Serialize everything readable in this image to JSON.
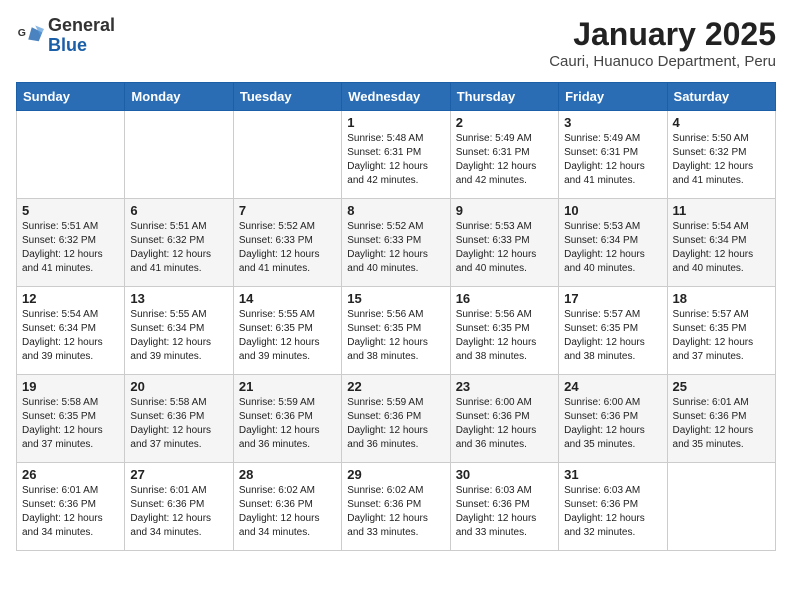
{
  "header": {
    "logo_general": "General",
    "logo_blue": "Blue",
    "title": "January 2025",
    "subtitle": "Cauri, Huanuco Department, Peru"
  },
  "weekdays": [
    "Sunday",
    "Monday",
    "Tuesday",
    "Wednesday",
    "Thursday",
    "Friday",
    "Saturday"
  ],
  "weeks": [
    [
      {
        "day": "",
        "info": ""
      },
      {
        "day": "",
        "info": ""
      },
      {
        "day": "",
        "info": ""
      },
      {
        "day": "1",
        "info": "Sunrise: 5:48 AM\nSunset: 6:31 PM\nDaylight: 12 hours and 42 minutes."
      },
      {
        "day": "2",
        "info": "Sunrise: 5:49 AM\nSunset: 6:31 PM\nDaylight: 12 hours and 42 minutes."
      },
      {
        "day": "3",
        "info": "Sunrise: 5:49 AM\nSunset: 6:31 PM\nDaylight: 12 hours and 41 minutes."
      },
      {
        "day": "4",
        "info": "Sunrise: 5:50 AM\nSunset: 6:32 PM\nDaylight: 12 hours and 41 minutes."
      }
    ],
    [
      {
        "day": "5",
        "info": "Sunrise: 5:51 AM\nSunset: 6:32 PM\nDaylight: 12 hours and 41 minutes."
      },
      {
        "day": "6",
        "info": "Sunrise: 5:51 AM\nSunset: 6:32 PM\nDaylight: 12 hours and 41 minutes."
      },
      {
        "day": "7",
        "info": "Sunrise: 5:52 AM\nSunset: 6:33 PM\nDaylight: 12 hours and 41 minutes."
      },
      {
        "day": "8",
        "info": "Sunrise: 5:52 AM\nSunset: 6:33 PM\nDaylight: 12 hours and 40 minutes."
      },
      {
        "day": "9",
        "info": "Sunrise: 5:53 AM\nSunset: 6:33 PM\nDaylight: 12 hours and 40 minutes."
      },
      {
        "day": "10",
        "info": "Sunrise: 5:53 AM\nSunset: 6:34 PM\nDaylight: 12 hours and 40 minutes."
      },
      {
        "day": "11",
        "info": "Sunrise: 5:54 AM\nSunset: 6:34 PM\nDaylight: 12 hours and 40 minutes."
      }
    ],
    [
      {
        "day": "12",
        "info": "Sunrise: 5:54 AM\nSunset: 6:34 PM\nDaylight: 12 hours and 39 minutes."
      },
      {
        "day": "13",
        "info": "Sunrise: 5:55 AM\nSunset: 6:34 PM\nDaylight: 12 hours and 39 minutes."
      },
      {
        "day": "14",
        "info": "Sunrise: 5:55 AM\nSunset: 6:35 PM\nDaylight: 12 hours and 39 minutes."
      },
      {
        "day": "15",
        "info": "Sunrise: 5:56 AM\nSunset: 6:35 PM\nDaylight: 12 hours and 38 minutes."
      },
      {
        "day": "16",
        "info": "Sunrise: 5:56 AM\nSunset: 6:35 PM\nDaylight: 12 hours and 38 minutes."
      },
      {
        "day": "17",
        "info": "Sunrise: 5:57 AM\nSunset: 6:35 PM\nDaylight: 12 hours and 38 minutes."
      },
      {
        "day": "18",
        "info": "Sunrise: 5:57 AM\nSunset: 6:35 PM\nDaylight: 12 hours and 37 minutes."
      }
    ],
    [
      {
        "day": "19",
        "info": "Sunrise: 5:58 AM\nSunset: 6:35 PM\nDaylight: 12 hours and 37 minutes."
      },
      {
        "day": "20",
        "info": "Sunrise: 5:58 AM\nSunset: 6:36 PM\nDaylight: 12 hours and 37 minutes."
      },
      {
        "day": "21",
        "info": "Sunrise: 5:59 AM\nSunset: 6:36 PM\nDaylight: 12 hours and 36 minutes."
      },
      {
        "day": "22",
        "info": "Sunrise: 5:59 AM\nSunset: 6:36 PM\nDaylight: 12 hours and 36 minutes."
      },
      {
        "day": "23",
        "info": "Sunrise: 6:00 AM\nSunset: 6:36 PM\nDaylight: 12 hours and 36 minutes."
      },
      {
        "day": "24",
        "info": "Sunrise: 6:00 AM\nSunset: 6:36 PM\nDaylight: 12 hours and 35 minutes."
      },
      {
        "day": "25",
        "info": "Sunrise: 6:01 AM\nSunset: 6:36 PM\nDaylight: 12 hours and 35 minutes."
      }
    ],
    [
      {
        "day": "26",
        "info": "Sunrise: 6:01 AM\nSunset: 6:36 PM\nDaylight: 12 hours and 34 minutes."
      },
      {
        "day": "27",
        "info": "Sunrise: 6:01 AM\nSunset: 6:36 PM\nDaylight: 12 hours and 34 minutes."
      },
      {
        "day": "28",
        "info": "Sunrise: 6:02 AM\nSunset: 6:36 PM\nDaylight: 12 hours and 34 minutes."
      },
      {
        "day": "29",
        "info": "Sunrise: 6:02 AM\nSunset: 6:36 PM\nDaylight: 12 hours and 33 minutes."
      },
      {
        "day": "30",
        "info": "Sunrise: 6:03 AM\nSunset: 6:36 PM\nDaylight: 12 hours and 33 minutes."
      },
      {
        "day": "31",
        "info": "Sunrise: 6:03 AM\nSunset: 6:36 PM\nDaylight: 12 hours and 32 minutes."
      },
      {
        "day": "",
        "info": ""
      }
    ]
  ]
}
